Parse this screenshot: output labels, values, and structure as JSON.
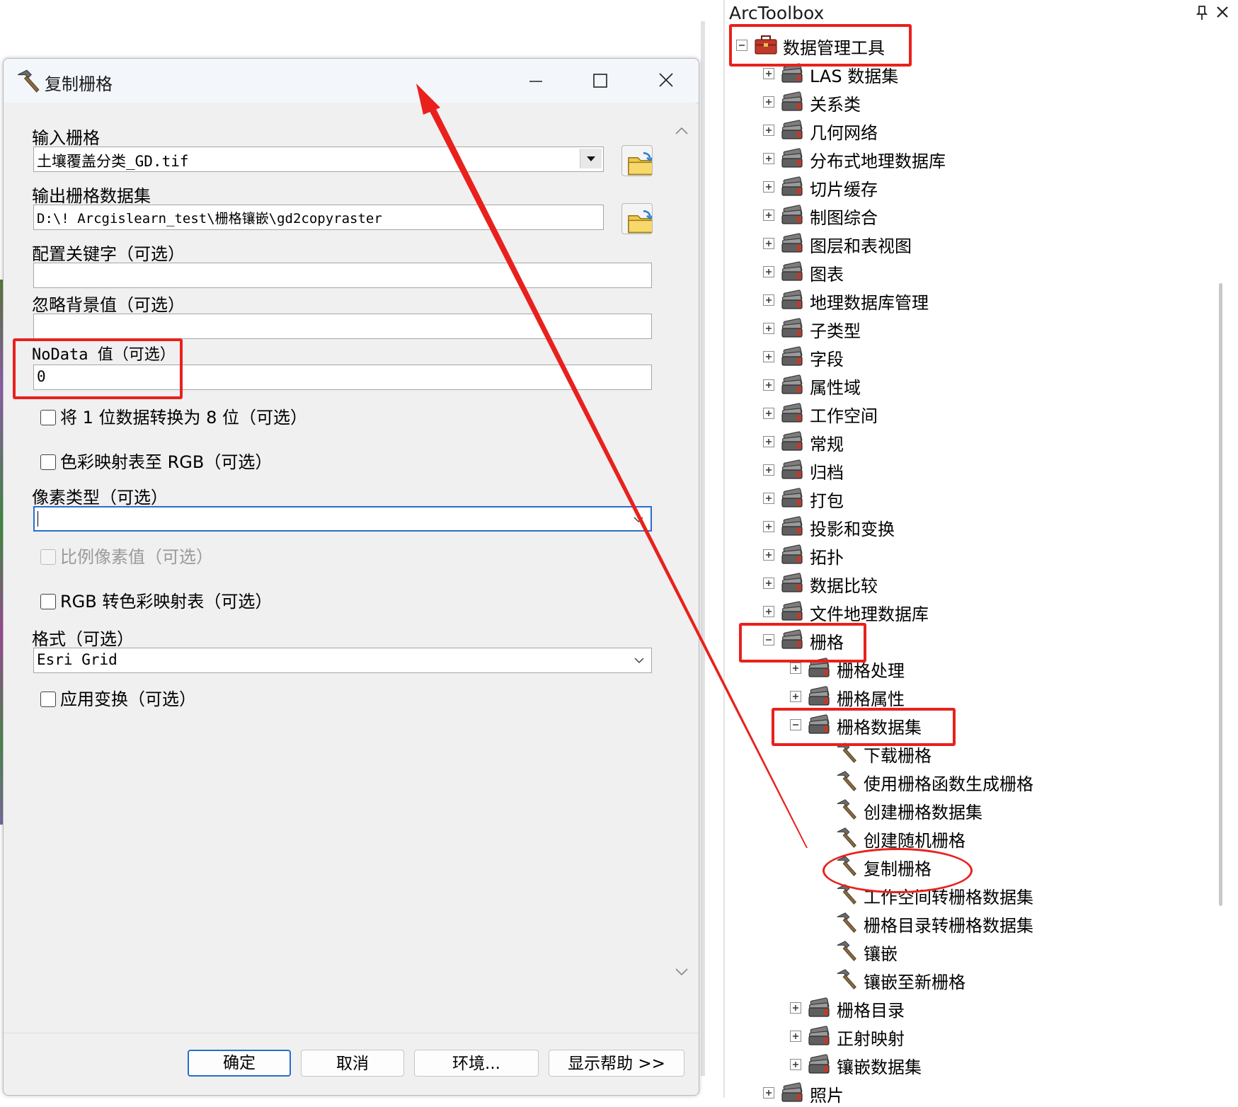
{
  "dialog": {
    "title": "复制栅格",
    "fields": {
      "input_raster_label": "输入栅格",
      "input_raster_value": "土壤覆盖分类_GD.tif",
      "output_dataset_label": "输出栅格数据集",
      "output_dataset_value": "D:\\! Arcgislearn_test\\栅格镶嵌\\gd2copyraster",
      "config_keyword_label": "配置关键字（可选）",
      "config_keyword_value": "",
      "ignore_bg_label": "忽略背景值（可选）",
      "ignore_bg_value": "",
      "nodata_label": "NoData 值（可选）",
      "nodata_value": "0",
      "convert_1bit_label": "将 1 位数据转换为 8 位（可选）",
      "colormap_rgb_label": "色彩映射表至 RGB（可选）",
      "pixel_type_label": "像素类型（可选）",
      "pixel_type_value": "",
      "scale_pixel_label": "比例像素值（可选）",
      "rgb_colormap_label": "RGB 转色彩映射表（可选）",
      "format_label": "格式（可选）",
      "format_value": "Esri Grid",
      "transform_label": "应用变换（可选）"
    },
    "buttons": {
      "ok": "确定",
      "cancel": "取消",
      "environments": "环境...",
      "help": "显示帮助 >>"
    }
  },
  "toolbox": {
    "title": "ArcToolbox",
    "root": "数据管理工具",
    "toolsets_level1": [
      "LAS 数据集",
      "关系类",
      "几何网络",
      "分布式地理数据库",
      "切片缓存",
      "制图综合",
      "图层和表视图",
      "图表",
      "地理数据库管理",
      "子类型",
      "字段",
      "属性域",
      "工作空间",
      "常规",
      "归档",
      "打包",
      "投影和变换",
      "拓扑",
      "数据比较",
      "文件地理数据库",
      "栅格"
    ],
    "raster_children": [
      "栅格处理",
      "栅格属性",
      "栅格数据集"
    ],
    "raster_dataset_tools": [
      "下载栅格",
      "使用栅格函数生成栅格",
      "创建栅格数据集",
      "创建随机栅格",
      "复制栅格",
      "工作空间转栅格数据集",
      "栅格目录转栅格数据集",
      "镶嵌",
      "镶嵌至新栅格"
    ],
    "raster_after": [
      "栅格目录",
      "正射映射",
      "镶嵌数据集"
    ],
    "next_level1": "照片"
  },
  "colors": {
    "highlight": "#e8211d",
    "focus_border": "#2b6ccf",
    "toolbox_red": "#c0392b"
  }
}
